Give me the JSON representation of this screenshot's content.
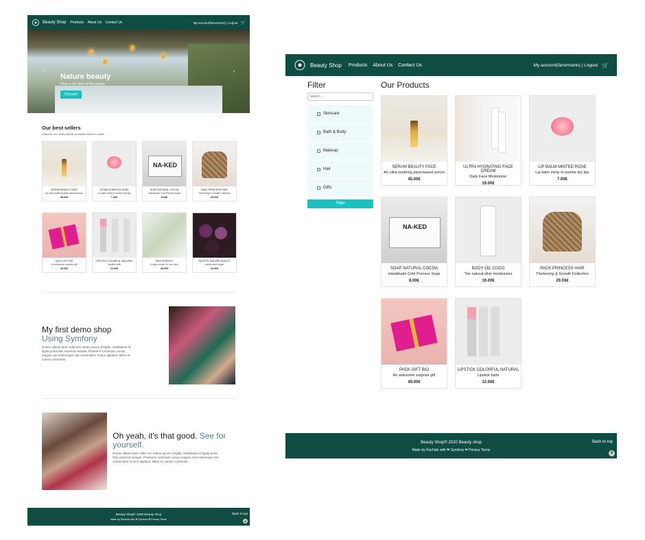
{
  "nav": {
    "brand": "Beauty Shop",
    "links": [
      "Products",
      "About Us",
      "Contact Us"
    ],
    "account": "My account(fanvrmann) | Logout",
    "account_right": "My account(fanvrmann) | Logout"
  },
  "home": {
    "hero": {
      "title": "Nature beauty",
      "subtitle": "Here is the best of this planet",
      "button": "Discover"
    },
    "best": {
      "title": "Our best sellers",
      "subtitle": "Discover our most popular products based on sales"
    },
    "products": [
      {
        "name": "SERUM BEAUTY FACE",
        "desc": "An ultra-soothing plant-based serum",
        "price": "45.00€"
      },
      {
        "name": "LIP BALM MINTED ROSE",
        "desc": "Lip balm minty to soothe dry lips",
        "price": "7.00€"
      },
      {
        "name": "SOAP NATURAL COCOA",
        "desc": "Handmade Cold Process Soap",
        "price": "8.00€"
      },
      {
        "name": "PACK PRINCESS HAIR",
        "desc": "Thickening & Growth Collection",
        "price": "29.00€"
      },
      {
        "name": "PACK GIFT BIO",
        "desc": "An awesome surprise gift",
        "price": "49.00€"
      },
      {
        "name": "LIPSTICK COLORFUL NATURAL",
        "desc": "Lipstick balm",
        "price": "12.00€"
      },
      {
        "name": "SKIN PERFECT",
        "desc": "A daily routine for your skin",
        "price": "28.00€"
      },
      {
        "name": "PALETTE NATURE BEAUTY",
        "desc": "colorful and vegan",
        "price": "23.00€"
      }
    ],
    "demo": {
      "title": "My first demo shop",
      "title_muted": "Using Symfony",
      "text": "Donec ullamcorper nulla non metus auctor fringilla. Vestibulum id ligula porta felis euismod semper. Praesent commodo cursus magna, vel scelerisque nisl consectetur. Fusce dapibus, tellus ac cursus commodo."
    },
    "good": {
      "title": "Oh yeah, it's that good.",
      "title_muted": "See for yourself.",
      "text": "Donec ullamcorper nulla non metus auctor fringilla. Vestibulum id ligula porta felis euismod semper. Praesent commodo cursus magna, vel scelerisque nisl consectetur. Fusce dapibus, tellus ac cursus commodo."
    }
  },
  "filter": {
    "title": "Filter",
    "search_placeholder": "search ...",
    "categories": [
      "Skincare",
      "Bath & Body",
      "Makeup",
      "Hair",
      "Gifts"
    ],
    "button": "Filter"
  },
  "products_page": {
    "title": "Our Products",
    "products": [
      {
        "name": "SERUM BEAUTY FACE",
        "desc": "An ultra-soothing plant-based serum",
        "price": "45.00€"
      },
      {
        "name": "ULTRA HYDRATING FACE CREAM",
        "desc": "Daily Face Moisturizer",
        "price": "19.00€"
      },
      {
        "name": "LIP BALM MINTED ROSE",
        "desc": "Lip balm minty to soothe dry lips",
        "price": "7.00€"
      },
      {
        "name": "SOAP NATURAL COCOA",
        "desc": "Handmade Cold Process Soap",
        "price": "8.00€"
      },
      {
        "name": "BODY OIL COCO",
        "desc": "The natural elixir moisturises",
        "price": "19.00€"
      },
      {
        "name": "PACK PRINCESS HAIR",
        "desc": "Thickening & Growth Collection",
        "price": "29.00€"
      },
      {
        "name": "PACK GIFT BIO",
        "desc": "An awesome surprise gift",
        "price": "49.00€"
      },
      {
        "name": "LIPSTICK COLORFUL NATURAL",
        "desc": "Lipstick balm",
        "price": "12.00€"
      }
    ]
  },
  "footer": {
    "copyright": "Beauty Shop© 2020 Beauty shop",
    "made_by": "Made by Rachida with ❤ Symfony ❤ Privacy Terms",
    "back_to_top": "Back to top",
    "sf_badge": "sf"
  },
  "colors": {
    "brand": "#0f4d43",
    "accent": "#17c3c0"
  }
}
